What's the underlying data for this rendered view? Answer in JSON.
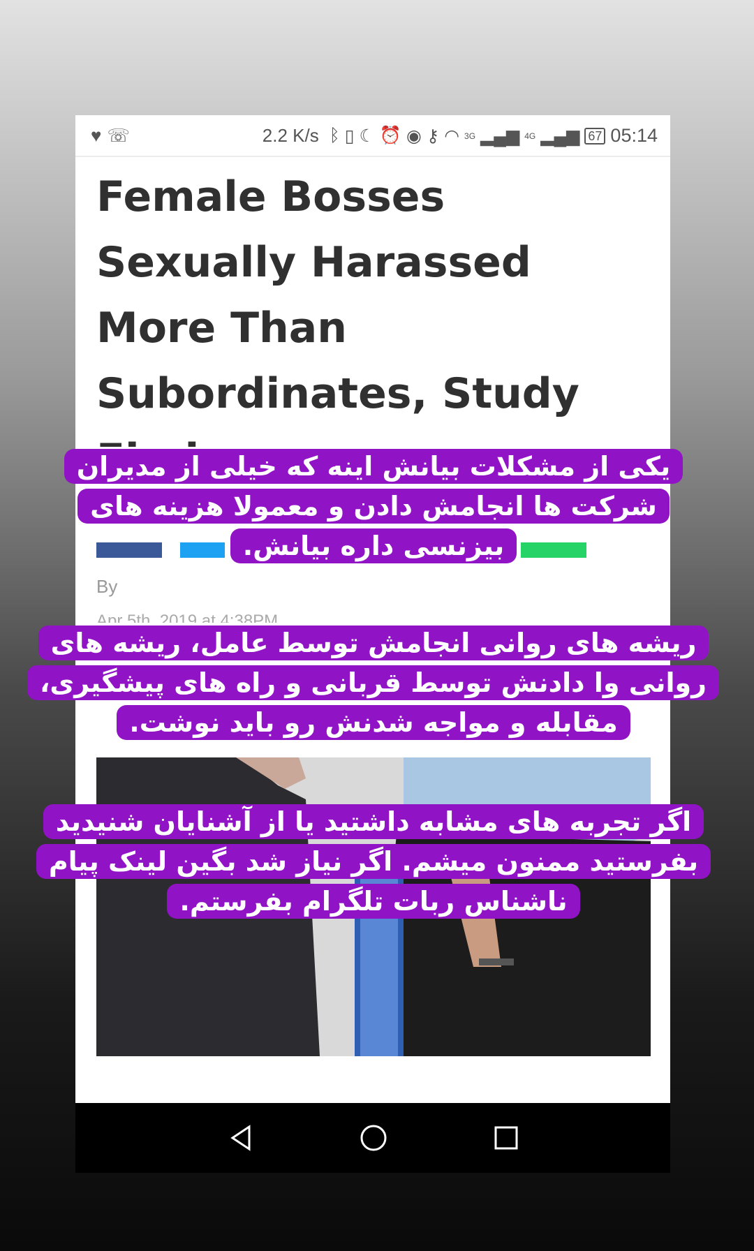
{
  "status_bar": {
    "network_speed": "2.2 K/s",
    "network_3g": "3G",
    "network_4g": "4G",
    "battery": "67",
    "time": "05:14"
  },
  "article": {
    "headline": "Female Bosses Sexually Harassed More Than Subordinates, Study Finds",
    "byline": "By",
    "date": "Apr 5th, 2019 at 4:38PM",
    "share_colors": {
      "facebook": "#3b5998",
      "twitter": "#1da1f2",
      "whatsapp": "#25d366"
    }
  },
  "captions": [
    "یکی از مشکلات بیانش اینه که خیلی از مدیران شرکت ها انجامش دادن و معمولا هزینه های بیزنسی داره بیانش.",
    "ریشه های روانی انجامش توسط عامل، ریشه های روانی وا دادنش توسط قربانی و راه های پیشگیری، مقابله و مواجه شدنش رو باید نوشت.",
    "اگر تجربه های مشابه داشتید یا از آشنایان شنیدید بفرستید ممنون میشم. اگر نیاز شد بگین لینک پیام ناشناس ربات تلگرام بفرستم."
  ],
  "caption_color": "#9013c6",
  "icons": {
    "status_left": [
      "heart-rate-icon",
      "missed-call-icon"
    ],
    "status_right": [
      "bluetooth-icon",
      "vibrate-icon",
      "moon-icon",
      "alarm-icon",
      "eye-icon",
      "key-icon",
      "wifi-icon",
      "signal-icon"
    ],
    "nav": [
      "back-icon",
      "home-icon",
      "recents-icon"
    ]
  }
}
